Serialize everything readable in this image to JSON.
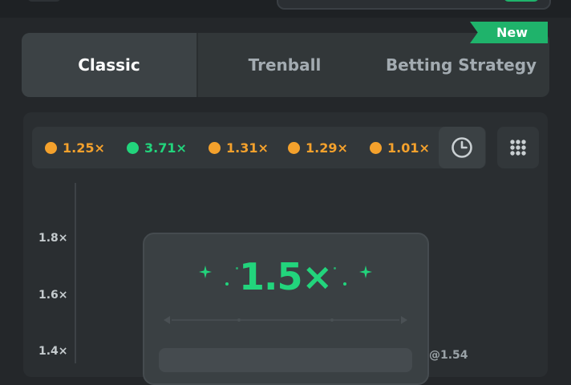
{
  "tabs": [
    {
      "label": "Classic",
      "active": true
    },
    {
      "label": "Trenball",
      "active": false
    },
    {
      "label": "Betting Strategy",
      "active": false
    }
  ],
  "new_badge": "New",
  "history": [
    {
      "value": "1.25×",
      "color": "#f4a12c"
    },
    {
      "value": "3.71×",
      "color": "#22d47c"
    },
    {
      "value": "1.31×",
      "color": "#f4a12c"
    },
    {
      "value": "1.29×",
      "color": "#f4a12c"
    },
    {
      "value": "1.01×",
      "color": "#f4a12c"
    }
  ],
  "history_buttons": {
    "history_icon": "clock-icon",
    "grid_icon": "grid-icon"
  },
  "y_axis": {
    "ticks": [
      "1.8×",
      "1.6×",
      "1.4×"
    ]
  },
  "current_multiplier": "1.5×",
  "cashout_label": "@1.54",
  "colors": {
    "accent_green": "#22d47c",
    "accent_orange": "#f4a12c",
    "background": "#24272a"
  }
}
